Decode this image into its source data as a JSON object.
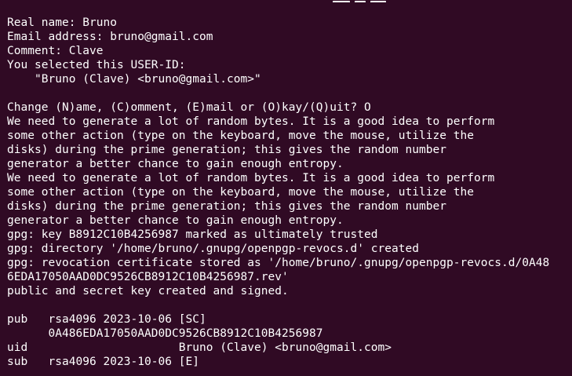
{
  "terminal": {
    "background": "#300a24",
    "foreground": "#ffffff",
    "lines": [
      "Real name: Bruno",
      "Email address: bruno@gmail.com",
      "Comment: Clave",
      "You selected this USER-ID:",
      "    \"Bruno (Clave) <bruno@gmail.com>\"",
      "",
      "Change (N)ame, (C)omment, (E)mail or (O)kay/(Q)uit? O",
      "We need to generate a lot of random bytes. It is a good idea to perform",
      "some other action (type on the keyboard, move the mouse, utilize the",
      "disks) during the prime generation; this gives the random number",
      "generator a better chance to gain enough entropy.",
      "We need to generate a lot of random bytes. It is a good idea to perform",
      "some other action (type on the keyboard, move the mouse, utilize the",
      "disks) during the prime generation; this gives the random number",
      "generator a better chance to gain enough entropy.",
      "gpg: key B8912C10B4256987 marked as ultimately trusted",
      "gpg: directory '/home/bruno/.gnupg/openpgp-revocs.d' created",
      "gpg: revocation certificate stored as '/home/bruno/.gnupg/openpgp-revocs.d/0A48",
      "6EDA17050AAD0DC9526CB8912C10B4256987.rev'",
      "public and secret key created and signed.",
      "",
      "pub   rsa4096 2023-10-06 [SC]",
      "      0A486EDA17050AAD0DC9526CB8912C10B4256987",
      "uid                      Bruno (Clave) <bruno@gmail.com>",
      "sub   rsa4096 2023-10-06 [E]"
    ]
  }
}
